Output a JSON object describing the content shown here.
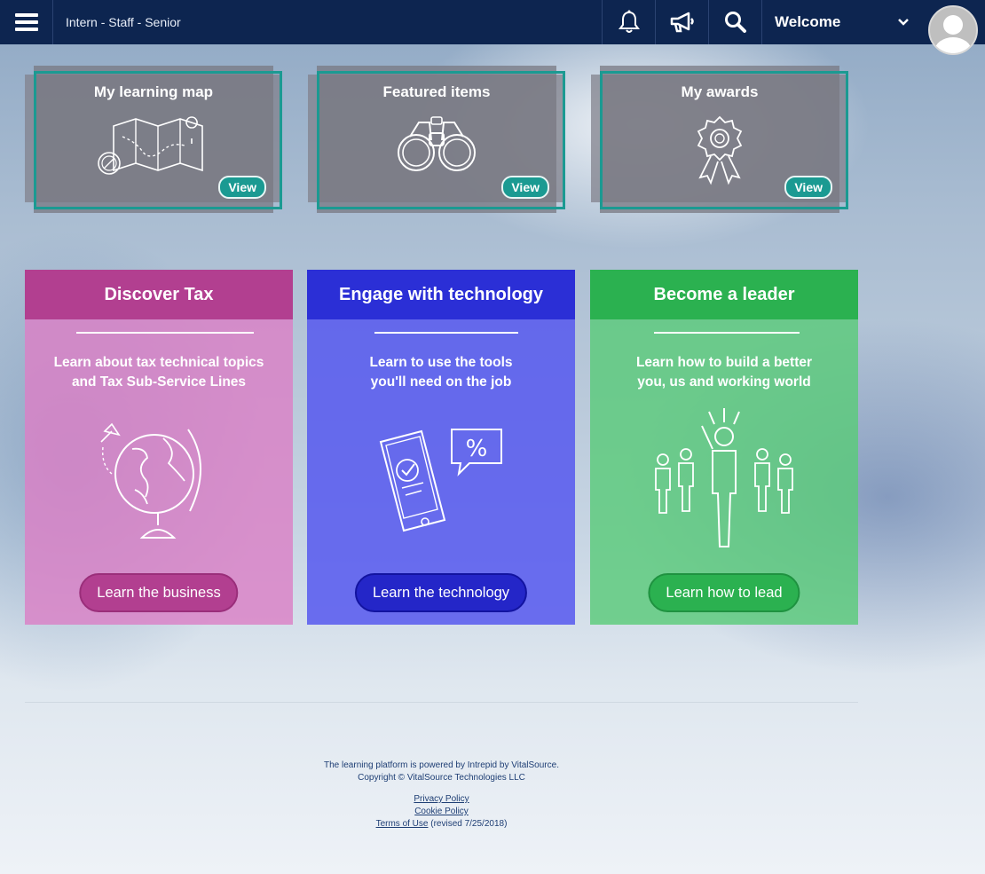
{
  "header": {
    "breadcrumb": "Intern - Staff - Senior",
    "welcome_label": "Welcome",
    "bg_color": "#0d2550"
  },
  "tiles": [
    {
      "title": "My learning map",
      "view_label": "View",
      "icon": "map-icon"
    },
    {
      "title": "Featured items",
      "view_label": "View",
      "icon": "binoculars-icon"
    },
    {
      "title": "My awards",
      "view_label": "View",
      "icon": "award-ribbon-icon"
    }
  ],
  "cards": [
    {
      "title": "Discover Tax",
      "description_line1": "Learn about tax technical topics",
      "description_line2": "and  Tax Sub-Service Lines",
      "cta": "Learn the business",
      "icon": "globe-icon",
      "head_color": "#b23f90",
      "body_color": "#d780c4",
      "cta_color": "#b23f90"
    },
    {
      "title": "Engage with technology",
      "description_line1": "Learn to use the tools",
      "description_line2": "you'll need on the job",
      "cta": "Learn the technology",
      "icon": "smartphone-icon",
      "head_color": "#2b2fd6",
      "body_color": "#5a5cee",
      "cta_color": "#2426c8"
    },
    {
      "title": "Become a leader",
      "description_line1": "Learn how to build a better",
      "description_line2": "you, us and working world",
      "cta": "Learn how to lead",
      "icon": "leader-group-icon",
      "head_color": "#2bb150",
      "body_color": "#5ccb7a",
      "cta_color": "#2bb150"
    }
  ],
  "footer": {
    "powered_by": "The learning platform is powered by Intrepid by VitalSource.",
    "copyright": "Copyright © VitalSource Technologies LLC",
    "privacy": "Privacy Policy",
    "cookie": "Cookie Policy",
    "terms": "Terms of Use",
    "revised": " (revised 7/25/2018)"
  }
}
